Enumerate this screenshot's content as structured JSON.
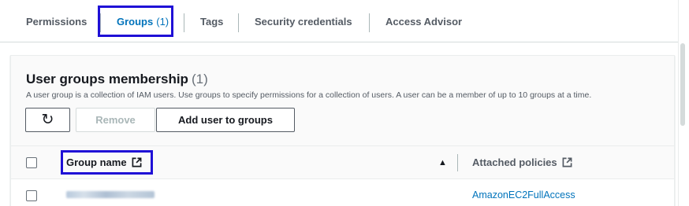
{
  "tabs": [
    {
      "label": "Permissions"
    },
    {
      "label": "Groups",
      "count": "(1)"
    },
    {
      "label": "Tags"
    },
    {
      "label": "Security credentials"
    },
    {
      "label": "Access Advisor"
    }
  ],
  "active_tab": "Groups",
  "panel": {
    "title": "User groups membership",
    "count": "(1)",
    "description": "A user group is a collection of IAM users. Use groups to specify permissions for a collection of users. A user can be a member of up to 10 groups at a time."
  },
  "buttons": {
    "refresh_icon": "refresh-icon",
    "remove_label": "Remove",
    "add_label": "Add user to groups"
  },
  "table": {
    "columns": [
      {
        "label": "Group name",
        "icon": "external-link-icon",
        "sort": "ascending"
      },
      {
        "label": "Attached policies",
        "icon": "external-link-icon"
      }
    ],
    "rows": [
      {
        "group_name": "[redacted]",
        "policy": "AmazonEC2FullAccess"
      }
    ]
  },
  "colors": {
    "link": "#0073bb",
    "highlight_box": "#1f10d6",
    "text": "#16191f",
    "muted": "#545b64"
  }
}
